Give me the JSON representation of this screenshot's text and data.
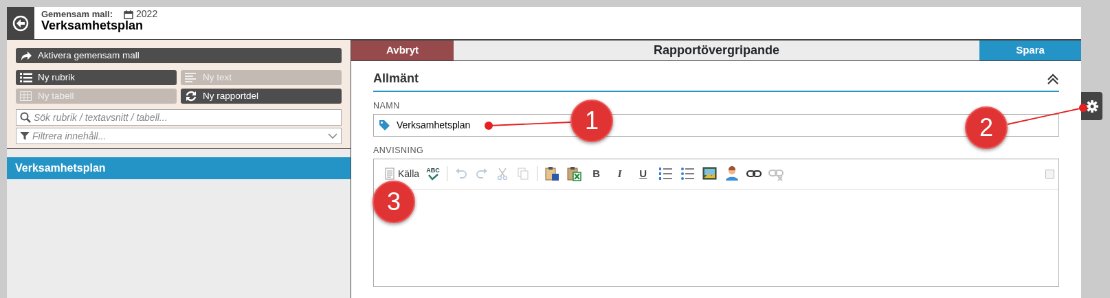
{
  "header": {
    "template_label": "Gemensam mall:",
    "year": "2022",
    "title": "Verksamhetsplan"
  },
  "sidebar": {
    "actions": [
      {
        "kind": "share",
        "label": "Aktivera gemensam mall",
        "disabled": false
      },
      {
        "kind": "list",
        "label": "Ny rubrik",
        "disabled": false
      },
      {
        "kind": "text",
        "label": "Ny text",
        "disabled": true
      },
      {
        "kind": "table",
        "label": "Ny tabell",
        "disabled": true
      },
      {
        "kind": "refresh",
        "label": "Ny rapportdel",
        "disabled": false
      }
    ],
    "search": {
      "placeholder": "Sök rubrik / textavsnitt / tabell..."
    },
    "filter": {
      "placeholder": "Filtrera innehåll..."
    },
    "items": [
      {
        "label": "Verksamhetsplan",
        "selected": true
      }
    ]
  },
  "topbar": {
    "cancel": "Avbryt",
    "title": "Rapportövergripande",
    "save": "Spara"
  },
  "section": {
    "title": "Allmänt",
    "expanded": true
  },
  "name_field": {
    "label": "NAMN",
    "value": "Verksamhetsplan"
  },
  "editor": {
    "label": "ANVISNING",
    "toolbar": [
      {
        "kind": "source",
        "label": "Källa",
        "disabled": false
      },
      {
        "kind": "spellcheck",
        "label": "ABC",
        "disabled": false
      },
      {
        "kind": "separator"
      },
      {
        "kind": "undo",
        "disabled": true
      },
      {
        "kind": "redo",
        "disabled": true
      },
      {
        "kind": "cut",
        "disabled": true
      },
      {
        "kind": "copy",
        "disabled": true
      },
      {
        "kind": "separator"
      },
      {
        "kind": "paste-word",
        "disabled": false
      },
      {
        "kind": "paste-excel",
        "disabled": false
      },
      {
        "kind": "bold",
        "label": "B",
        "disabled": false
      },
      {
        "kind": "italic",
        "label": "I",
        "disabled": false
      },
      {
        "kind": "underline",
        "label": "U",
        "disabled": false
      },
      {
        "kind": "ordered-list",
        "disabled": false
      },
      {
        "kind": "bullet-list",
        "disabled": false
      },
      {
        "kind": "image",
        "disabled": false
      },
      {
        "kind": "person",
        "disabled": false
      },
      {
        "kind": "link",
        "disabled": false
      },
      {
        "kind": "unlink",
        "disabled": true
      }
    ]
  },
  "callouts": [
    {
      "label": "1"
    },
    {
      "label": "2"
    },
    {
      "label": "3"
    }
  ]
}
